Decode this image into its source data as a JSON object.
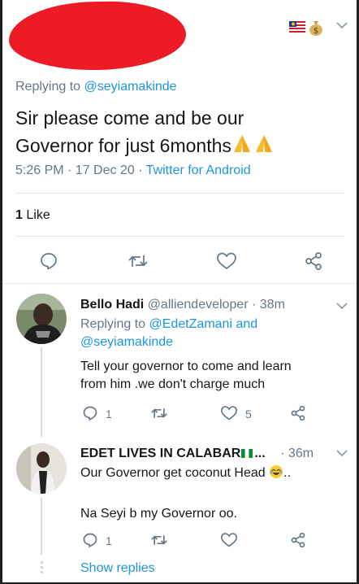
{
  "main_tweet": {
    "replying_label": "Replying to",
    "replying_handle": "@seyiamakinde",
    "text_line1": "Sir please come and be our",
    "text_line2": "Governor for just 6months",
    "emoji": "🙏🙏",
    "time": "5:26 PM · 17 Dec 20 · ",
    "source": "Twitter for Android",
    "likes_count": "1",
    "likes_label": "Like"
  },
  "replies": [
    {
      "name": "Bello Hadi",
      "handle": "@alliendeveloper",
      "time": "· 38m",
      "replying_label": "Replying to",
      "replying_handles_1": "@EdetZamani and",
      "replying_handles_2": "@seyiamakinde",
      "text_1": "Tell your governor to come and learn",
      "text_2": "from him .we don't charge much",
      "reply_count": "1",
      "retweet_count": "",
      "like_count": "5"
    },
    {
      "name": "EDET LIVES IN CALABAR",
      "name_suffix": "...",
      "time": "· 36m",
      "text_1": "Our Governor get coconut Head",
      "text_1_suffix": "..",
      "text_2": "Na Seyi b my Governor oo.",
      "reply_count": "1"
    }
  ],
  "show_replies": "Show replies",
  "colors": {
    "link": "#1b95e0",
    "muted": "#657786",
    "icon": "#657786",
    "redaction": "#ec1b24"
  },
  "icons": [
    "reply-icon",
    "retweet-icon",
    "like-icon",
    "share-icon",
    "chevron-down-icon",
    "flag-icon",
    "money-bag-icon"
  ]
}
